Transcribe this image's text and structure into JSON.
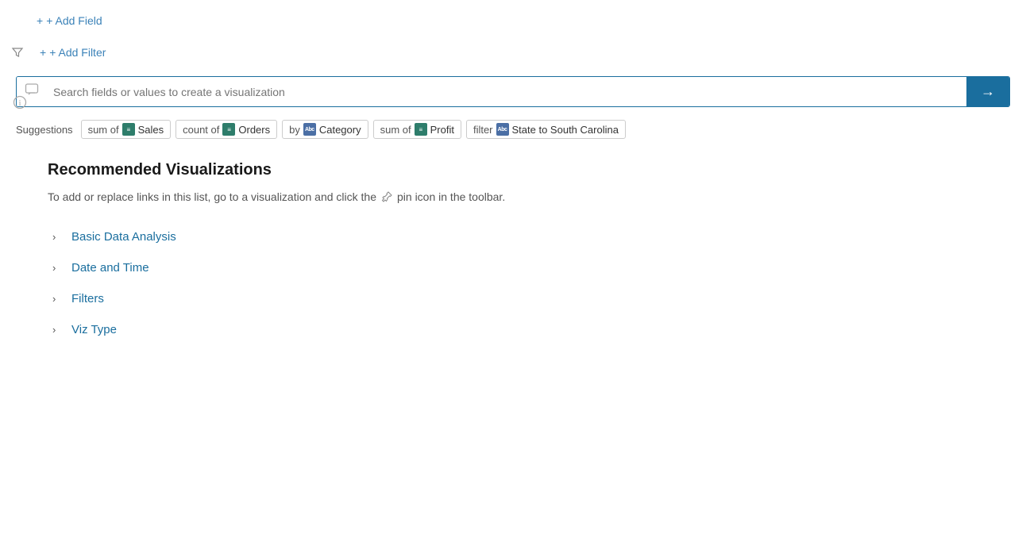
{
  "toolbar": {
    "add_field_label": "+ Add Field",
    "add_filter_label": "+ Add Filter"
  },
  "search": {
    "placeholder": "Search fields or values to create a visualization"
  },
  "suggestions": {
    "label": "Suggestions",
    "chips": [
      {
        "id": "sum-sales",
        "prefix": "sum of",
        "icon_type": "measure",
        "icon_label": "≡",
        "name": "Sales"
      },
      {
        "id": "count-orders",
        "prefix": "count of",
        "icon_type": "measure",
        "icon_label": "≡",
        "name": "Orders"
      },
      {
        "id": "by-category",
        "prefix": "by",
        "icon_type": "dimension",
        "icon_label": "Abc",
        "name": "Category"
      },
      {
        "id": "sum-profit",
        "prefix": "sum of",
        "icon_type": "measure",
        "icon_label": "≡",
        "name": "Profit"
      },
      {
        "id": "filter-state",
        "prefix": "filter",
        "icon_type": "dimension",
        "icon_label": "Abc",
        "name": "State to South Carolina"
      }
    ]
  },
  "recommended": {
    "title": "Recommended Visualizations",
    "description_before": "To add or replace links in this list, go to a visualization and click the",
    "description_after": "pin icon in the toolbar.",
    "items": [
      {
        "id": "basic-data-analysis",
        "label": "Basic Data Analysis"
      },
      {
        "id": "date-and-time",
        "label": "Date and Time"
      },
      {
        "id": "filters",
        "label": "Filters"
      },
      {
        "id": "viz-type",
        "label": "Viz Type"
      }
    ]
  }
}
